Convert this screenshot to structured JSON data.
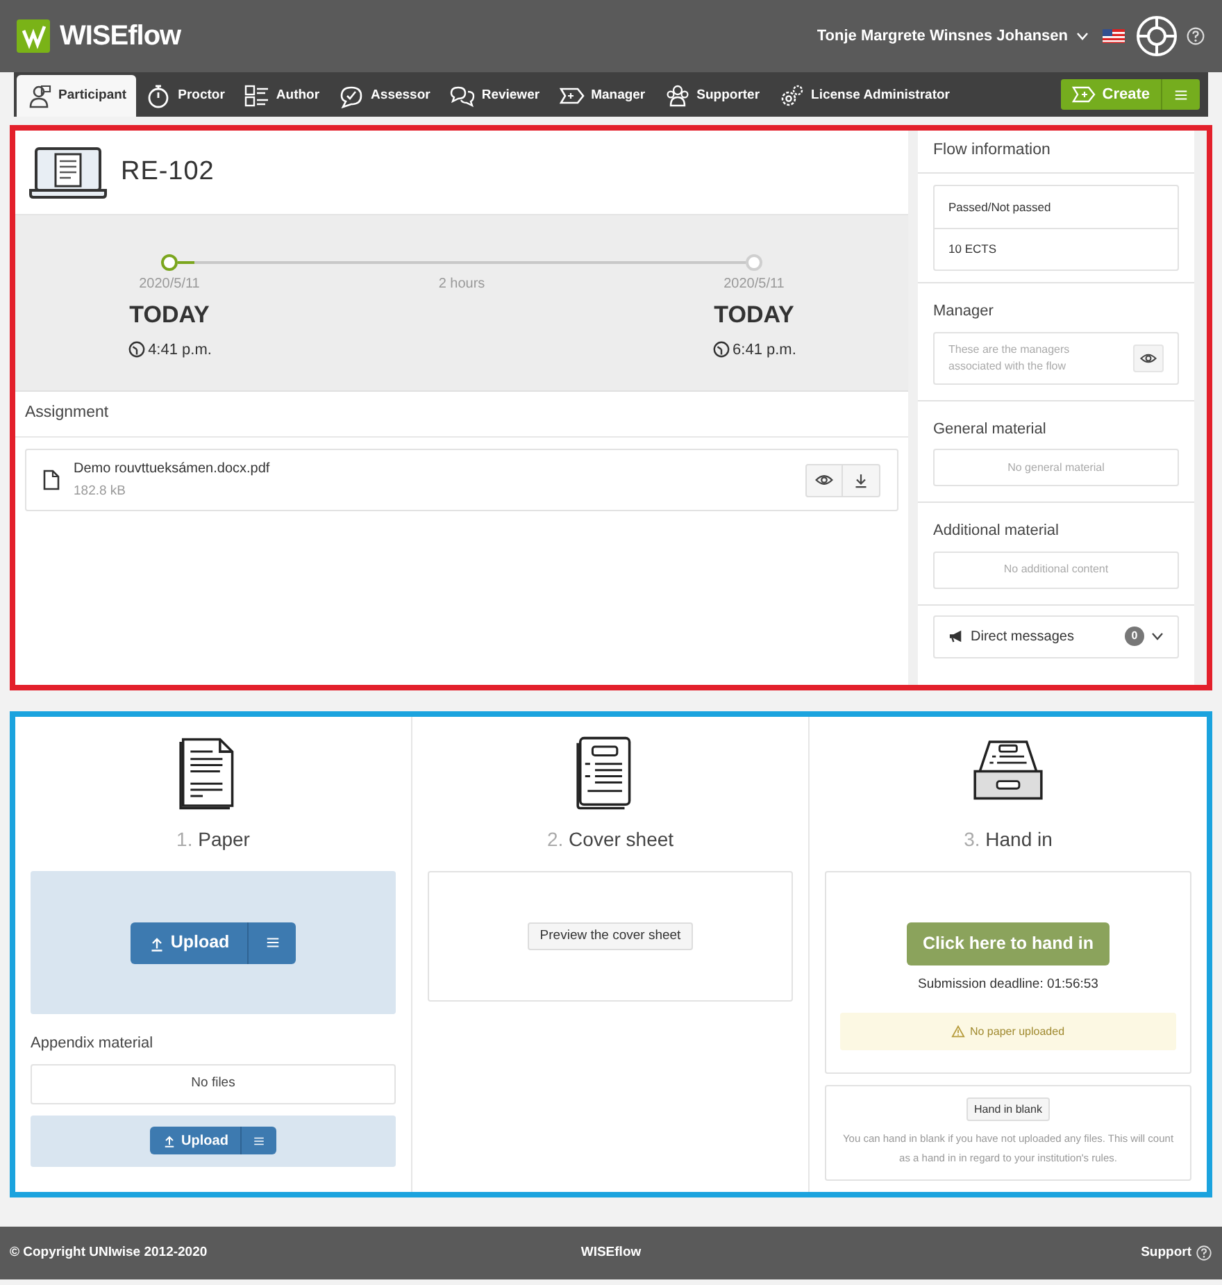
{
  "header": {
    "brand": "WISEflow",
    "user": "Tonje Margrete Winsnes Johansen"
  },
  "nav": [
    {
      "label": "Participant",
      "kind": "participant",
      "selected": true
    },
    {
      "label": "Proctor",
      "kind": "stopwatch",
      "selected": false
    },
    {
      "label": "Author",
      "kind": "list",
      "selected": false
    },
    {
      "label": "Assessor",
      "kind": "bubble",
      "selected": false
    },
    {
      "label": "Reviewer",
      "kind": "bubbles",
      "selected": false
    },
    {
      "label": "Manager",
      "kind": "tag",
      "selected": false
    },
    {
      "label": "Supporter",
      "kind": "people",
      "selected": false
    },
    {
      "label": "License Administrator",
      "kind": "gears",
      "selected": false
    }
  ],
  "create_button": "Create",
  "flow": {
    "title": "RE-102",
    "timeline": {
      "level": 0.03,
      "duration": "2 hours",
      "start": {
        "date": "2020/5/11",
        "day": "TODAY",
        "time": "4:41 p.m."
      },
      "end": {
        "date": "2020/5/11",
        "day": "TODAY",
        "time": "6:41 p.m."
      }
    },
    "assignment": {
      "heading": "Assignment",
      "file": {
        "name": "Demo rouvttueksámen.docx.pdf",
        "size": "182.8 kB"
      }
    }
  },
  "flow_information": {
    "heading": "Flow information",
    "items": [
      "Passed/Not passed",
      "10 ECTS"
    ]
  },
  "manager": {
    "heading": "Manager",
    "text": "These are the managers associated with the flow"
  },
  "general_material": {
    "heading": "General material",
    "empty": "No general material"
  },
  "additional_material": {
    "heading": "Additional material",
    "empty": "No additional content"
  },
  "direct_messages": {
    "label": "Direct messages",
    "count": "0"
  },
  "steps": [
    {
      "kind": "paper",
      "number": "1.",
      "title": "Paper"
    },
    {
      "kind": "cover",
      "number": "2.",
      "title": "Cover sheet"
    },
    {
      "kind": "tray",
      "number": "3.",
      "title": "Hand in"
    }
  ],
  "paper": {
    "upload": "Upload",
    "appendix_heading": "Appendix material",
    "appendix_empty": "No files",
    "appendix_upload": "Upload"
  },
  "cover_sheet": {
    "preview_button": "Preview the cover sheet"
  },
  "hand_in": {
    "button": "Click here to hand in",
    "deadline": "Submission deadline: 01:56:53",
    "warning": "No paper uploaded",
    "blank_button": "Hand in blank",
    "blank_note": "You can hand in blank if you have not uploaded any files. This will count as a hand in in regard to your institution's rules."
  },
  "footer": {
    "copyright": "© Copyright UNIwise 2012-2020",
    "brand": "WISEflow",
    "support": "Support"
  }
}
